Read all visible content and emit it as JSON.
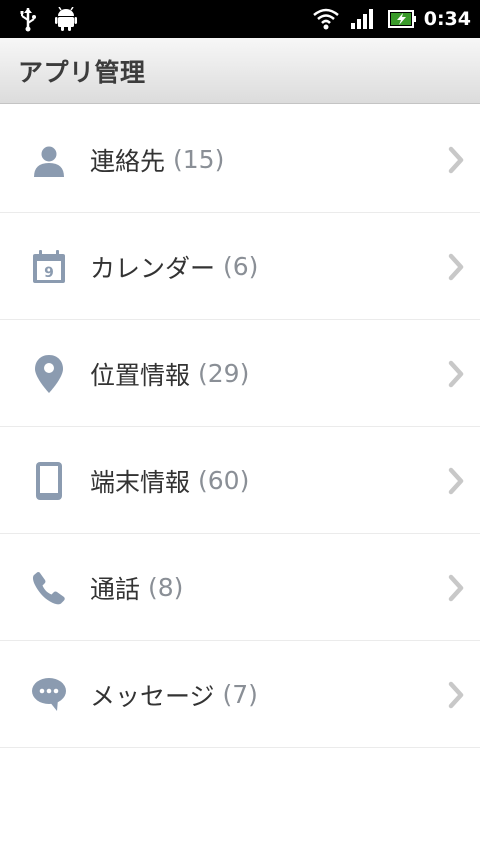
{
  "status_bar": {
    "time": "0:34",
    "icons": [
      "usb-icon",
      "android-icon",
      "wifi-icon",
      "signal-icon",
      "battery-charging-icon"
    ]
  },
  "header": {
    "title": "アプリ管理"
  },
  "list": {
    "items": [
      {
        "label": "連絡先",
        "count": "(15)",
        "icon": "person-icon"
      },
      {
        "label": "カレンダー",
        "count": "(6)",
        "icon": "calendar-icon",
        "icon_text": "9"
      },
      {
        "label": "位置情報",
        "count": "(29)",
        "icon": "location-pin-icon"
      },
      {
        "label": "端末情報",
        "count": "(60)",
        "icon": "phone-device-icon"
      },
      {
        "label": "通話",
        "count": "(8)",
        "icon": "phone-handset-icon"
      },
      {
        "label": "メッセージ",
        "count": "(7)",
        "icon": "chat-bubble-icon"
      }
    ]
  },
  "colors": {
    "icon": "#8b9bb0",
    "count": "#8a8f96",
    "chevron": "#c8c8c8"
  }
}
